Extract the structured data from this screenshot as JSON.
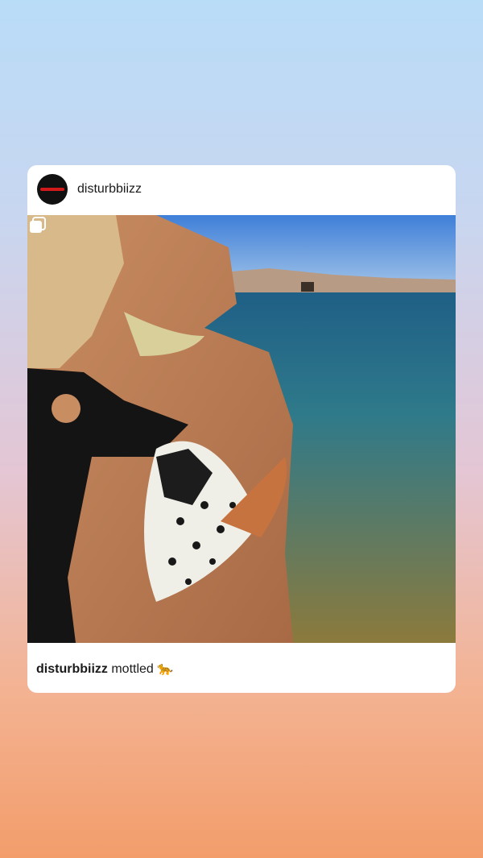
{
  "post": {
    "username": "disturbbiizz",
    "caption_user": "disturbbiizz",
    "caption_text": "mottled 🐆",
    "media_icon": "multiple-images-icon",
    "avatar_icon": "profile-avatar"
  }
}
